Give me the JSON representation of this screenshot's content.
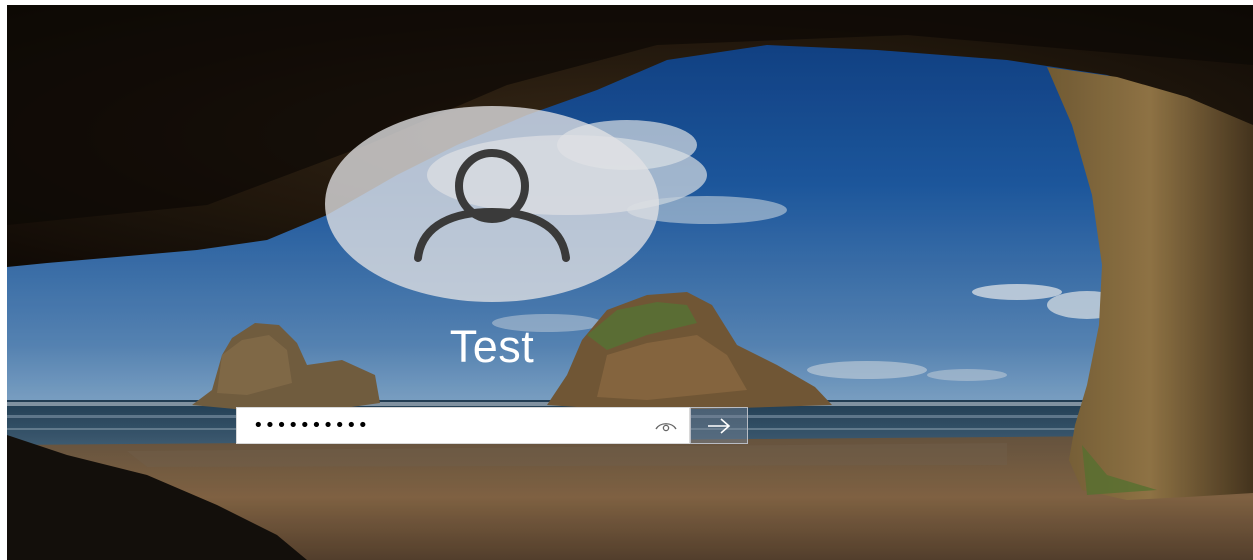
{
  "login": {
    "username": "Test",
    "password_masked": "••••••••••",
    "reveal_icon": "eye-icon",
    "submit_icon": "arrow-right-icon",
    "avatar_icon": "user-icon"
  },
  "colors": {
    "avatar_fill": "#E2E2E4",
    "user_glyph": "#3A3A3A",
    "field_bg": "#FFFFFF",
    "submit_bg": "#788496"
  }
}
